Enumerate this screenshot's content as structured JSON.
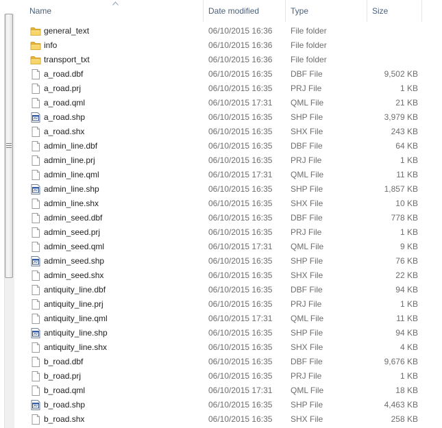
{
  "header": {
    "name": "Name",
    "date": "Date modified",
    "type": "Type",
    "size": "Size"
  },
  "icons": {
    "folder": "folder-icon",
    "file": "file-icon",
    "shp": "shapefile-icon"
  },
  "colors": {
    "header_text": "#4c607a",
    "secondary_text": "#6d6d6d",
    "folder_yellow": "#f1c84b"
  },
  "rows": [
    {
      "name": "general_text",
      "date": "06/10/2015 16:36",
      "type": "File folder",
      "size": "",
      "icon": "folder"
    },
    {
      "name": "info",
      "date": "06/10/2015 16:36",
      "type": "File folder",
      "size": "",
      "icon": "folder"
    },
    {
      "name": "transport_txt",
      "date": "06/10/2015 16:36",
      "type": "File folder",
      "size": "",
      "icon": "folder"
    },
    {
      "name": "a_road.dbf",
      "date": "06/10/2015 16:35",
      "type": "DBF File",
      "size": "9,502 KB",
      "icon": "file"
    },
    {
      "name": "a_road.prj",
      "date": "06/10/2015 16:35",
      "type": "PRJ File",
      "size": "1 KB",
      "icon": "file"
    },
    {
      "name": "a_road.qml",
      "date": "06/10/2015 17:31",
      "type": "QML File",
      "size": "21 KB",
      "icon": "file"
    },
    {
      "name": "a_road.shp",
      "date": "06/10/2015 16:35",
      "type": "SHP File",
      "size": "3,979 KB",
      "icon": "shp"
    },
    {
      "name": "a_road.shx",
      "date": "06/10/2015 16:35",
      "type": "SHX File",
      "size": "243 KB",
      "icon": "file"
    },
    {
      "name": "admin_line.dbf",
      "date": "06/10/2015 16:35",
      "type": "DBF File",
      "size": "64 KB",
      "icon": "file"
    },
    {
      "name": "admin_line.prj",
      "date": "06/10/2015 16:35",
      "type": "PRJ File",
      "size": "1 KB",
      "icon": "file"
    },
    {
      "name": "admin_line.qml",
      "date": "06/10/2015 17:31",
      "type": "QML File",
      "size": "11 KB",
      "icon": "file"
    },
    {
      "name": "admin_line.shp",
      "date": "06/10/2015 16:35",
      "type": "SHP File",
      "size": "1,857 KB",
      "icon": "shp"
    },
    {
      "name": "admin_line.shx",
      "date": "06/10/2015 16:35",
      "type": "SHX File",
      "size": "10 KB",
      "icon": "file"
    },
    {
      "name": "admin_seed.dbf",
      "date": "06/10/2015 16:35",
      "type": "DBF File",
      "size": "778 KB",
      "icon": "file"
    },
    {
      "name": "admin_seed.prj",
      "date": "06/10/2015 16:35",
      "type": "PRJ File",
      "size": "1 KB",
      "icon": "file"
    },
    {
      "name": "admin_seed.qml",
      "date": "06/10/2015 17:31",
      "type": "QML File",
      "size": "9 KB",
      "icon": "file"
    },
    {
      "name": "admin_seed.shp",
      "date": "06/10/2015 16:35",
      "type": "SHP File",
      "size": "76 KB",
      "icon": "shp"
    },
    {
      "name": "admin_seed.shx",
      "date": "06/10/2015 16:35",
      "type": "SHX File",
      "size": "22 KB",
      "icon": "file"
    },
    {
      "name": "antiquity_line.dbf",
      "date": "06/10/2015 16:35",
      "type": "DBF File",
      "size": "94 KB",
      "icon": "file"
    },
    {
      "name": "antiquity_line.prj",
      "date": "06/10/2015 16:35",
      "type": "PRJ File",
      "size": "1 KB",
      "icon": "file"
    },
    {
      "name": "antiquity_line.qml",
      "date": "06/10/2015 17:31",
      "type": "QML File",
      "size": "11 KB",
      "icon": "file"
    },
    {
      "name": "antiquity_line.shp",
      "date": "06/10/2015 16:35",
      "type": "SHP File",
      "size": "94 KB",
      "icon": "shp"
    },
    {
      "name": "antiquity_line.shx",
      "date": "06/10/2015 16:35",
      "type": "SHX File",
      "size": "4 KB",
      "icon": "file"
    },
    {
      "name": "b_road.dbf",
      "date": "06/10/2015 16:35",
      "type": "DBF File",
      "size": "9,676 KB",
      "icon": "file"
    },
    {
      "name": "b_road.prj",
      "date": "06/10/2015 16:35",
      "type": "PRJ File",
      "size": "1 KB",
      "icon": "file"
    },
    {
      "name": "b_road.qml",
      "date": "06/10/2015 17:31",
      "type": "QML File",
      "size": "18 KB",
      "icon": "file"
    },
    {
      "name": "b_road.shp",
      "date": "06/10/2015 16:35",
      "type": "SHP File",
      "size": "4,463 KB",
      "icon": "shp"
    },
    {
      "name": "b_road.shx",
      "date": "06/10/2015 16:35",
      "type": "SHX File",
      "size": "258 KB",
      "icon": "file"
    }
  ]
}
